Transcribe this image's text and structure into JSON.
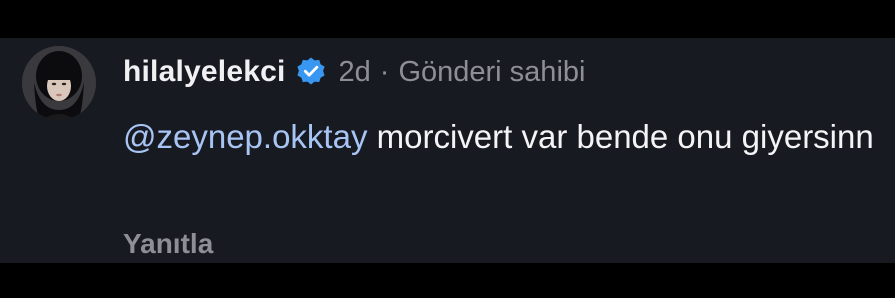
{
  "comment": {
    "username": "hilalyelekci",
    "verified_icon": "verified-badge-icon",
    "time": "2d",
    "separator": "·",
    "author_tag": "Gönderi sahibi",
    "mention": "@zeynep.okktay",
    "text": " morcivert var bende onu giyersinn",
    "reply_label": "Yanıtla"
  },
  "colors": {
    "background": "#000000",
    "panel": "#181a21",
    "mention": "#a7c4f5",
    "verified": "#3897f0",
    "muted": "#8e8f96"
  }
}
